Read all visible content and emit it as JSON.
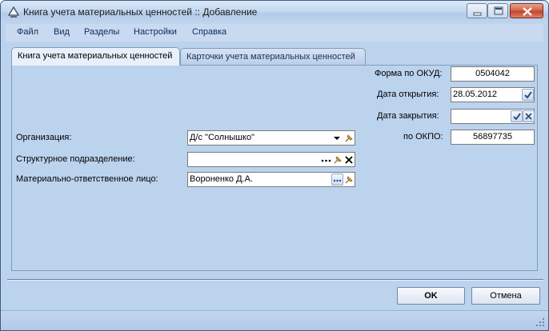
{
  "window": {
    "title": "Книга учета материальных ценностей :: Добавление"
  },
  "menu": [
    "Файл",
    "Вид",
    "Разделы",
    "Настройки",
    "Справка"
  ],
  "tabs": [
    "Книга учета материальных ценностей",
    "Карточки учета материальных ценностей"
  ],
  "form": {
    "okud_label": "Форма по ОКУД:",
    "okud_value": "0504042",
    "open_date_label": "Дата открытия:",
    "open_date_value": "28.05.2012",
    "close_date_label": "Дата закрытия:",
    "close_date_value": "",
    "okpo_label": "по ОКПО:",
    "okpo_value": "56897735",
    "org_label": "Организация:",
    "org_value": "Д/с \"Солнышко\"",
    "dept_label": "Структурное подразделение:",
    "dept_value": "",
    "person_label": "Материально-ответственное лицо:",
    "person_value": "Вороненко Д.А."
  },
  "buttons": {
    "ok": "OK",
    "cancel": "Отмена"
  }
}
